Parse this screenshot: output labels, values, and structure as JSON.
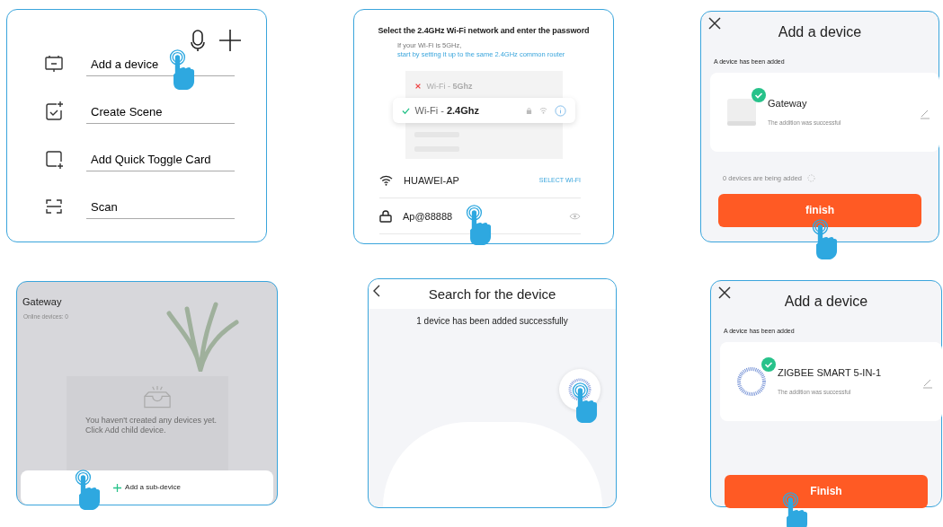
{
  "panels": [
    {
      "kind": "menu",
      "items": [
        {
          "label": "Add a device",
          "tapped": true
        },
        {
          "label": "Create Scene",
          "tapped": false
        },
        {
          "label": "Add Quick Toggle Card",
          "tapped": false
        },
        {
          "label": "Scan",
          "tapped": false
        }
      ]
    },
    {
      "kind": "wifi",
      "title": "Select the 2.4GHz Wi-Fi network and enter the password",
      "hint": "If your Wi-Fi is 5GHz,",
      "hint_link": "start by setting it up to the same 2.4GHz common router",
      "networks": [
        {
          "label": "Wi-Fi - **5Ghz**",
          "valid": false,
          "selected": false
        },
        {
          "label": "Wi-Fi - **2.4Ghz**",
          "valid": true,
          "selected": true
        }
      ],
      "ssid": "HUAWEI-AP",
      "select_label": "SELECT WI-FI",
      "password": "Ap@88888",
      "password_tapped": true
    },
    {
      "kind": "added",
      "title": "Add a device",
      "section": "A device has been added",
      "device": {
        "kind": "gateway",
        "name": "Gateway",
        "status": "The addition was successful"
      },
      "progress": "0 devices are being added",
      "button": "finish",
      "button_tapped": true
    },
    {
      "kind": "gateway",
      "title": "Gateway",
      "subtitle": "Online devices: 0",
      "empty_text": "You haven't created any devices yet. Click Add child device.",
      "button": "Add a sub-device",
      "button_tapped": true
    },
    {
      "kind": "search",
      "title": "Search for the device",
      "message": "1 device has been added successfully",
      "device_tapped": true
    },
    {
      "kind": "added",
      "title": "Add a device",
      "section": "A device has been added",
      "device": {
        "kind": "sensor",
        "name": "ZIGBEE SMART 5-IN-1",
        "status": "The addition was successful"
      },
      "button": "Finish",
      "button_tapped": true
    }
  ]
}
